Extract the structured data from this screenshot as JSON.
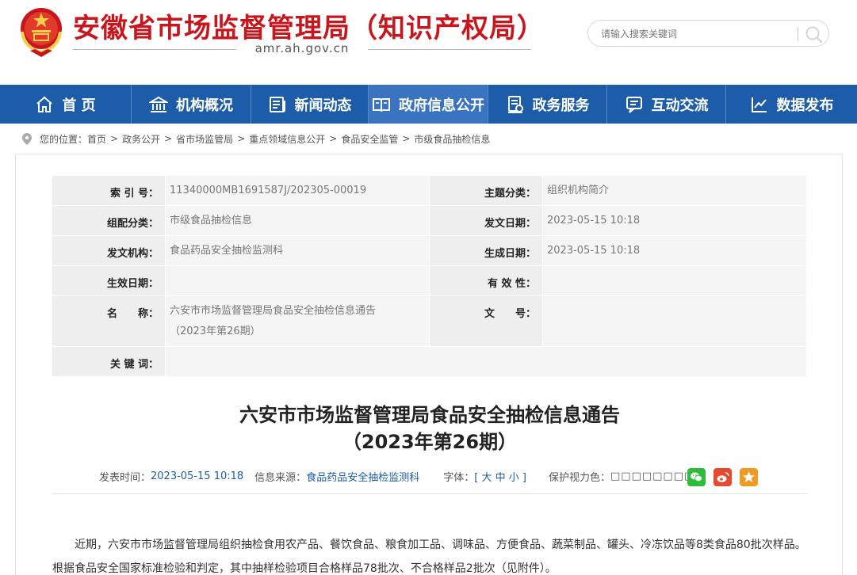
{
  "header": {
    "site_title": "安徽省市场监督管理局（知识产权局）",
    "site_domain": "amr.ah.gov.cn",
    "search_placeholder": "请输入搜索关键词"
  },
  "nav": {
    "items": [
      {
        "label": "首 页",
        "icon": "home-icon"
      },
      {
        "label": "机构概况",
        "icon": "building-icon"
      },
      {
        "label": "新闻动态",
        "icon": "news-icon"
      },
      {
        "label": "政府信息公开",
        "icon": "open-book-icon",
        "active": true
      },
      {
        "label": "政务服务",
        "icon": "service-doc-icon"
      },
      {
        "label": "互动交流",
        "icon": "chat-icon"
      },
      {
        "label": "数据发布",
        "icon": "chart-icon"
      }
    ]
  },
  "breadcrumb": {
    "prefix": "您的位置：",
    "items": [
      "首页",
      "政务公开",
      "省市场监管局",
      "重点领域信息公开",
      "食品安全监管",
      "市级食品抽检信息"
    ]
  },
  "meta": {
    "index_label": "索 引 号：",
    "index_value": "11340000MB1691587J/202305-00019",
    "topic_label": "主题分类：",
    "topic_value": "组织机构简介",
    "group_label": "组配分类：",
    "group_value": "市级食品抽检信息",
    "issue_date_label": "发文日期：",
    "issue_date_value": "2023-05-15 10:18",
    "org_label": "发文机构：",
    "org_value": "食品药品安全抽检监测科",
    "gen_date_label": "生成日期：",
    "gen_date_value": "2023-05-15 10:18",
    "eff_date_label": "生效日期：",
    "eff_date_value": "",
    "validity_label": "有 效 性：",
    "validity_value": "",
    "name_label": "名　　称：",
    "name_value_line1": "六安市市场监督管理局食品安全抽检信息通告",
    "name_value_line2": "（2023年第26期）",
    "doc_no_label": "文　　号：",
    "doc_no_value": "",
    "keywords_label": "关 键 词：",
    "keywords_value": ""
  },
  "article": {
    "title_line1": "六安市市场监督管理局食品安全抽检信息通告",
    "title_line2": "（2023年第26期）",
    "publish_label": "发表时间：",
    "publish_value": "2023-05-15 10:18",
    "source_label": "信息来源：",
    "source_value": "食品药品安全抽检监测科",
    "font_label": "字体：",
    "font_open": "[",
    "font_large": "大",
    "font_medium": "中",
    "font_small": "小",
    "font_close": "]",
    "care_label": "保护视力色：",
    "care_value": "□□□□□□□□□",
    "body": "近期，六安市市场监督管理局组织抽检食用农产品、餐饮食品、粮食加工品、调味品、方便食品、蔬菜制品、罐头、冷冻饮品等8类食品80批次样品。根据食品安全国家标准检验和判定，其中抽样检验项目合格样品78批次、不合格样品2批次（见附件）。"
  },
  "colors": {
    "brand_red": "#c8161d",
    "nav_blue": "#1c5ca8",
    "wechat_green": "#2dbd3a",
    "weibo_red": "#e6492f",
    "favorite_orange": "#f19a22"
  }
}
